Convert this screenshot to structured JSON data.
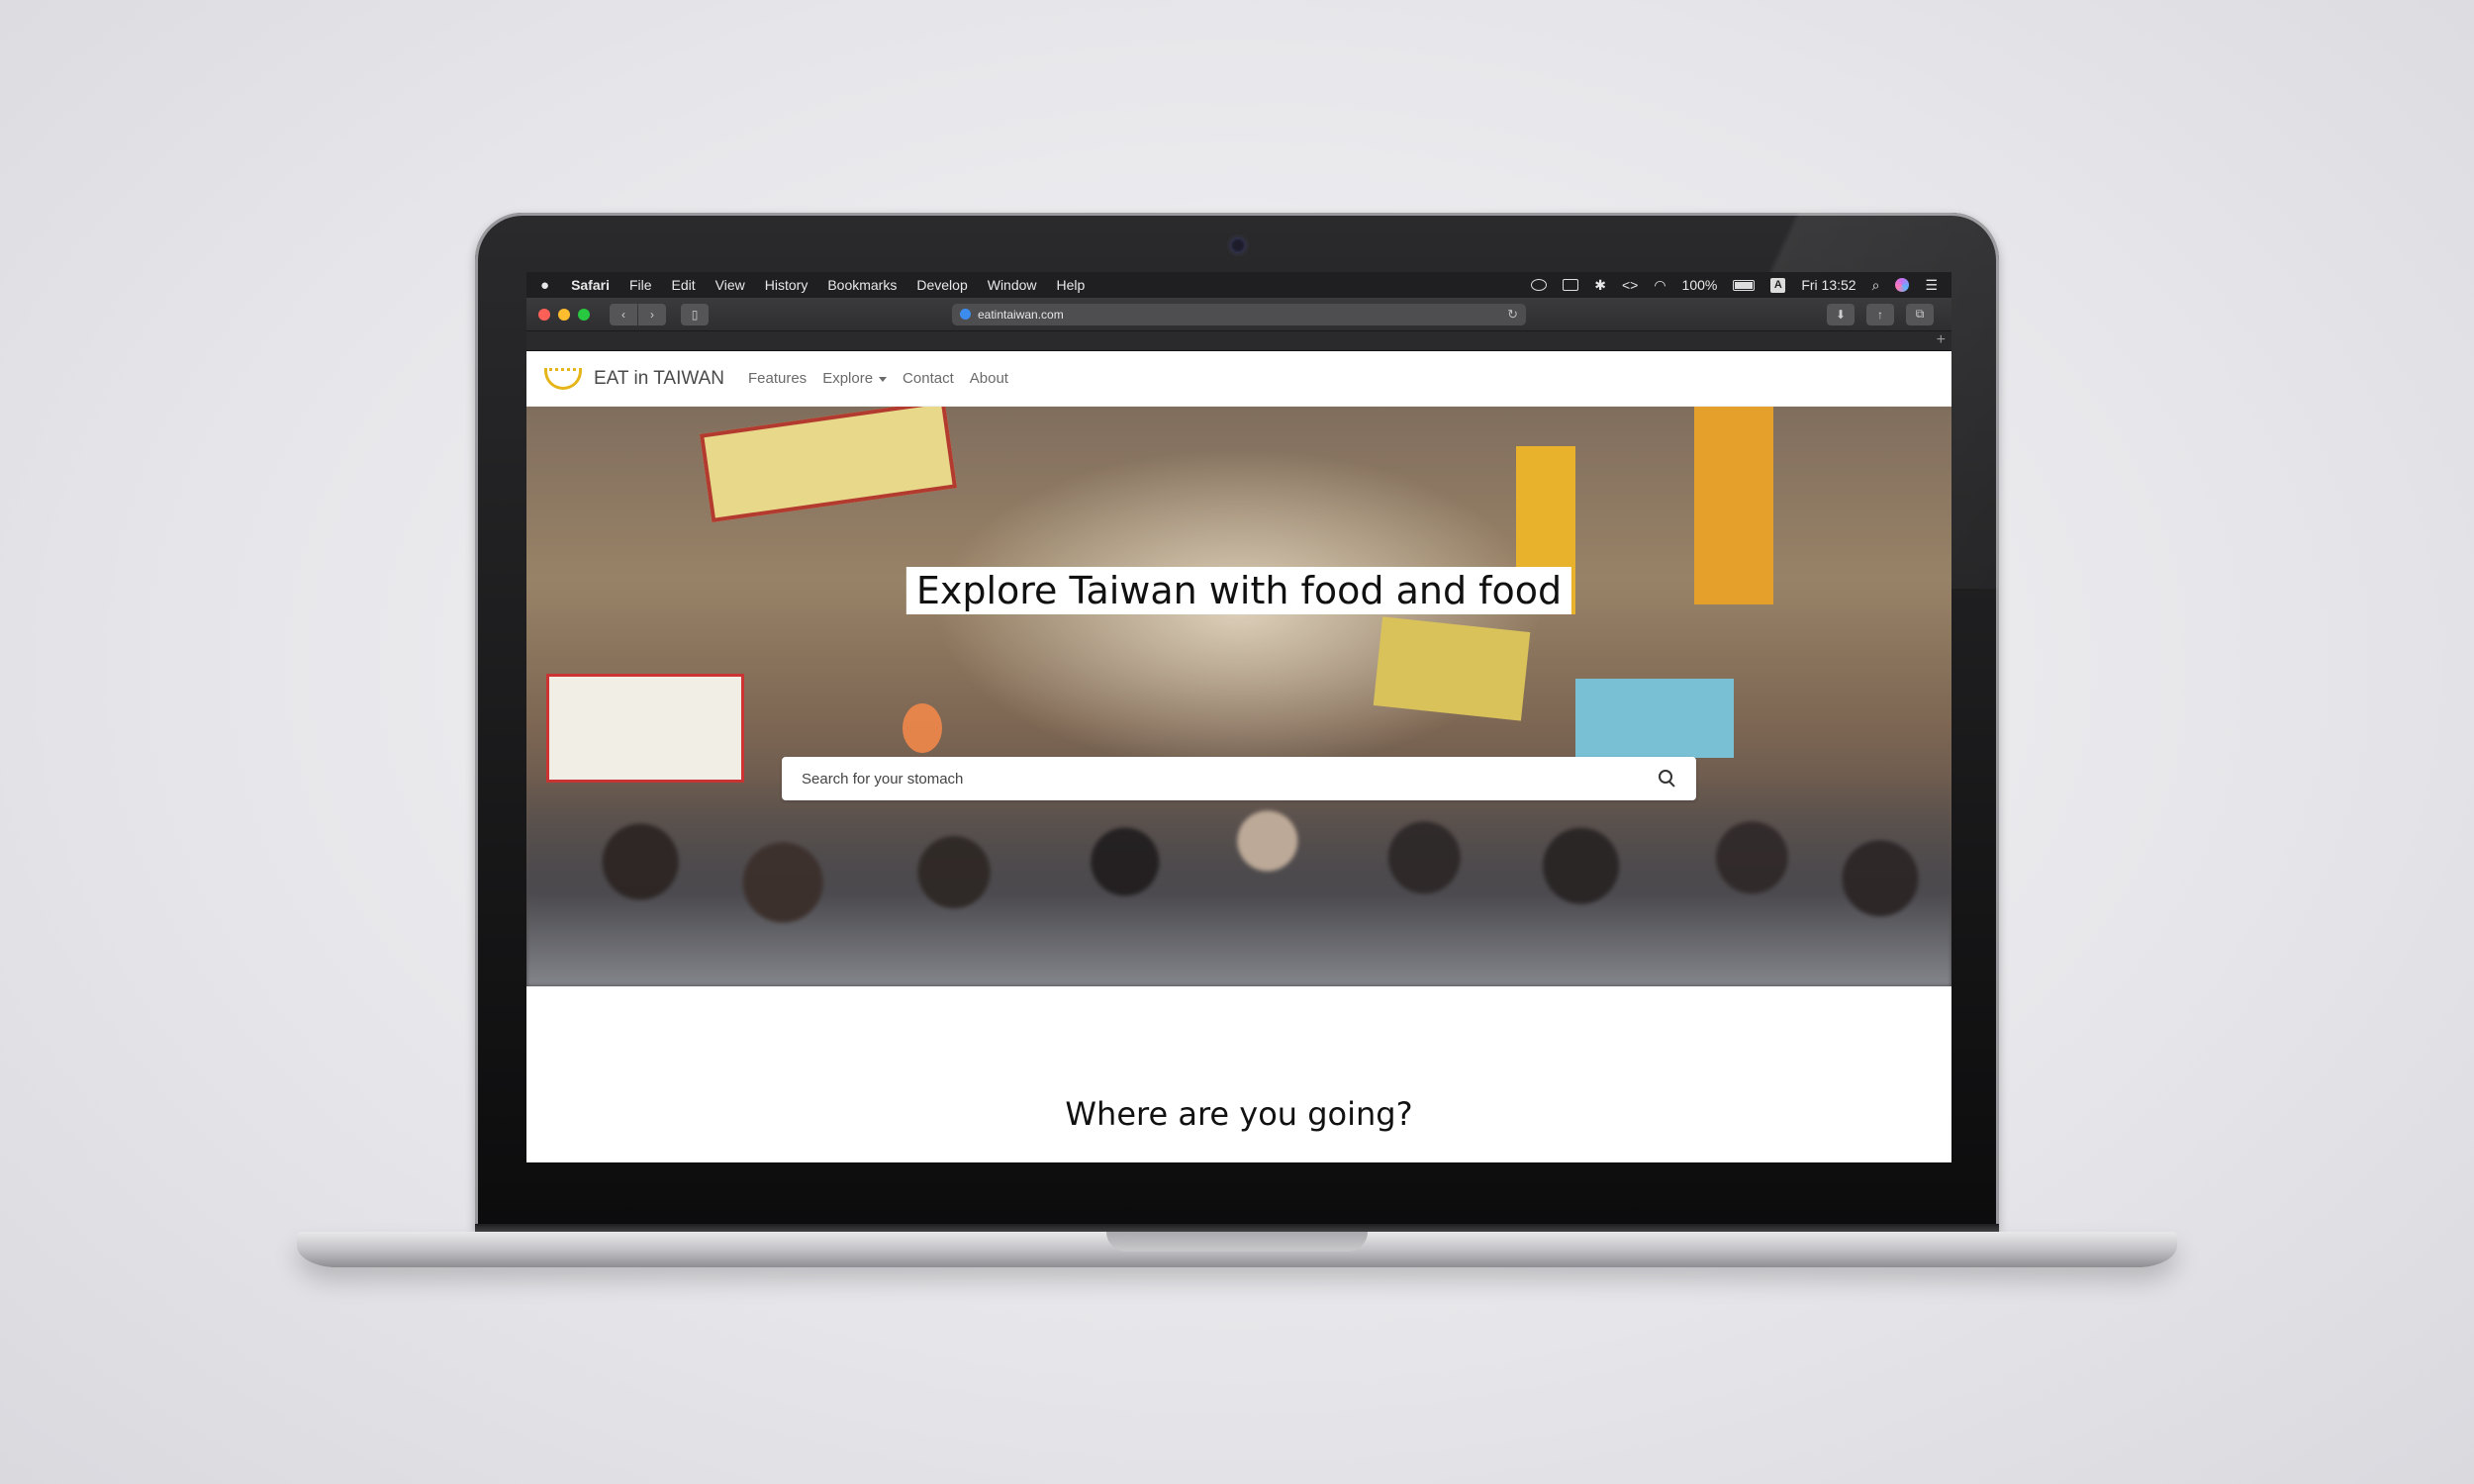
{
  "menubar": {
    "app": "Safari",
    "items": [
      "File",
      "Edit",
      "View",
      "History",
      "Bookmarks",
      "Develop",
      "Window",
      "Help"
    ],
    "battery": "100%",
    "clock": "Fri 13:52",
    "input_source": "A"
  },
  "browser": {
    "url": "eatintaiwan.com"
  },
  "site": {
    "brand": "EAT in TAIWAN",
    "nav": {
      "features": "Features",
      "explore": "Explore",
      "contact": "Contact",
      "about": "About"
    },
    "hero": {
      "title": "Explore Taiwan with food and food",
      "search_placeholder": "Search for your stomach"
    },
    "section_title": "Where are you going?"
  },
  "colors": {
    "brand_accent": "#e6b519",
    "menubar_bg": "#1f1f21",
    "toolbar_bg": "#2e2e30"
  }
}
